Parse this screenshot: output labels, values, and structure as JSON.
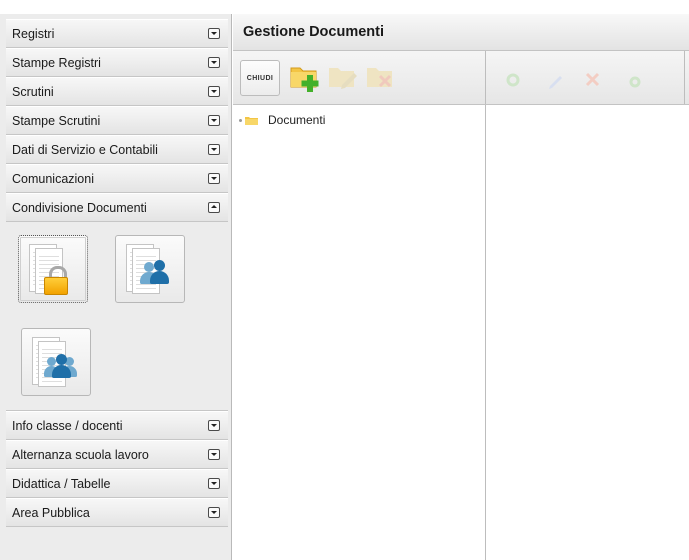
{
  "sidebar": {
    "sections_top": [
      {
        "label": "Registri",
        "state": "collapsed"
      },
      {
        "label": "Stampe Registri",
        "state": "collapsed"
      },
      {
        "label": "Scrutini",
        "state": "collapsed"
      },
      {
        "label": "Stampe Scrutini",
        "state": "collapsed"
      },
      {
        "label": "Dati di Servizio e Contabili",
        "state": "collapsed"
      },
      {
        "label": "Comunicazioni",
        "state": "collapsed"
      },
      {
        "label": "Condivisione Documenti",
        "state": "expanded"
      }
    ],
    "expanded_section_tiles": [
      {
        "icon": "document-lock-icon",
        "selected": true
      },
      {
        "icon": "document-user-icon",
        "selected": false
      },
      {
        "icon": "document-group-icon",
        "selected": false
      }
    ],
    "sections_bottom": [
      {
        "label": "Info classe / docenti",
        "state": "collapsed"
      },
      {
        "label": "Alternanza scuola lavoro",
        "state": "collapsed"
      },
      {
        "label": "Didattica / Tabelle",
        "state": "collapsed"
      },
      {
        "label": "Area Pubblica",
        "state": "collapsed"
      }
    ]
  },
  "main": {
    "title": "Gestione Documenti",
    "toolbar": {
      "close_label": "CHIUDI",
      "left_icons": [
        "new-folder-icon",
        "edit-folder-icon",
        "delete-folder-icon"
      ],
      "right_icons": [
        "add-file-icon",
        "edit-file-icon",
        "delete-file-icon",
        "upload-file-icon"
      ]
    },
    "tree": {
      "root_label": "Documenti"
    }
  },
  "colors": {
    "folder": "#f3c545",
    "add_green": "#43b02a",
    "disabled_icon": "#d9d2b8"
  }
}
